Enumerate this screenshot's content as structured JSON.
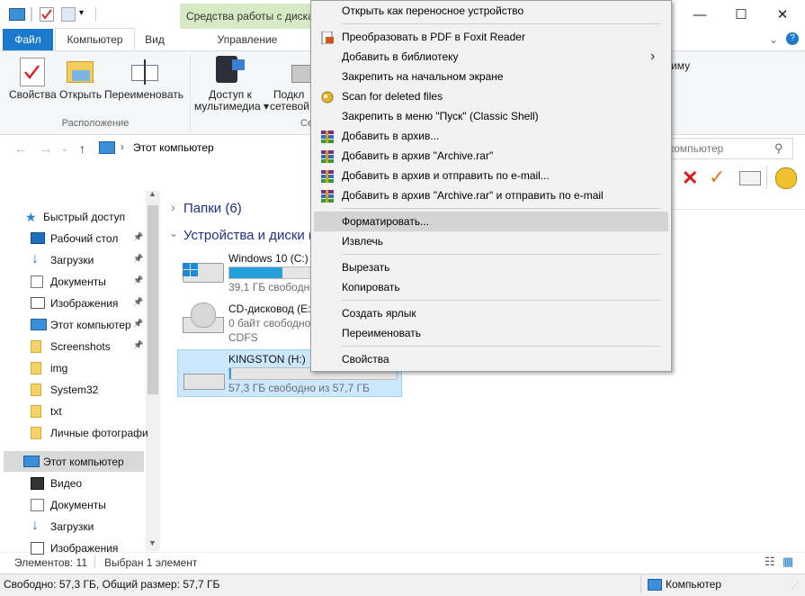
{
  "window": {
    "tools_tab": "Средства работы с дисками",
    "controls": {
      "minimize": "—",
      "maximize": "☐",
      "close": "✕"
    }
  },
  "ribbon": {
    "tabs": {
      "file": "Файл",
      "computer": "Компьютер",
      "view": "Вид",
      "manage": "Управление"
    },
    "buttons": {
      "properties": "Свойства",
      "open": "Открыть",
      "rename": "Переименовать",
      "media_access_l1": "Доступ к",
      "media_access_l2": "мультимедиа ▾",
      "network_l1": "Подкл",
      "network_l2": "сетевой",
      "right_partial": "иму"
    },
    "groups": {
      "location": "Расположение",
      "network_partial": "Се"
    }
  },
  "address": {
    "path": "Этот компьютер",
    "search_placeholder": "т компьютер"
  },
  "sidebar": {
    "quick_access": "Быстрый доступ",
    "items": [
      {
        "label": "Рабочий стол",
        "pinned": true
      },
      {
        "label": "Загрузки",
        "pinned": true
      },
      {
        "label": "Документы",
        "pinned": true
      },
      {
        "label": "Изображения",
        "pinned": true
      },
      {
        "label": "Этот компьютер",
        "pinned": true
      },
      {
        "label": "Screenshots",
        "pinned": true
      },
      {
        "label": "img",
        "pinned": false
      },
      {
        "label": "System32",
        "pinned": false
      },
      {
        "label": "txt",
        "pinned": false
      },
      {
        "label": "Личные фотографи",
        "pinned": false
      }
    ],
    "this_pc": "Этот компьютер",
    "this_pc_items": [
      "Видео",
      "Документы",
      "Загрузки",
      "Изображения"
    ]
  },
  "content": {
    "folders_head": "Папки (6)",
    "devices_head": "Устройства и диски (",
    "drives": [
      {
        "name": "Windows 10 (C:)",
        "free": "39,1 ГБ свободно",
        "fill_fraction": 0.66
      },
      {
        "name": "CD-дисковод (E:)",
        "free": "0 байт свободно",
        "fs": "CDFS"
      },
      {
        "name": "KINGSTON (H:)",
        "free": "57,3 ГБ свободно из 57,7 ГБ",
        "fill_fraction": 0.01
      }
    ]
  },
  "context_menu": {
    "items": [
      {
        "label": "Открыть как переносное устройство",
        "icon": "none"
      },
      {
        "label": "Преобразовать в PDF в Foxit Reader",
        "icon": "pdf-icon"
      },
      {
        "label": "Добавить в библиотеку",
        "icon": "none",
        "submenu": true
      },
      {
        "label": "Закрепить на начальном экране",
        "icon": "none"
      },
      {
        "label": "Scan for deleted files",
        "icon": "recovery-icon"
      },
      {
        "label": "Закрепить в меню \"Пуск\" (Classic Shell)",
        "icon": "none"
      },
      {
        "label": "Добавить в архив...",
        "icon": "winrar-icon"
      },
      {
        "label": "Добавить в архив \"Archive.rar\"",
        "icon": "winrar-icon"
      },
      {
        "label": "Добавить в архив и отправить по e-mail...",
        "icon": "winrar-icon"
      },
      {
        "label": "Добавить в архив \"Archive.rar\" и отправить по e-mail",
        "icon": "winrar-icon"
      },
      {
        "label": "Форматировать...",
        "icon": "none",
        "highlighted": true
      },
      {
        "label": "Извлечь",
        "icon": "none"
      },
      {
        "label": "Вырезать",
        "icon": "none"
      },
      {
        "label": "Копировать",
        "icon": "none"
      },
      {
        "label": "Создать ярлык",
        "icon": "none"
      },
      {
        "label": "Переименовать",
        "icon": "none"
      },
      {
        "label": "Свойства",
        "icon": "none"
      }
    ],
    "submenu_arrow": "›"
  },
  "status": {
    "items_count": "Элементов: 11",
    "selected": "Выбран 1 элемент",
    "free_info": "Свободно: 57,3 ГБ, Общий размер: 57,7 ГБ",
    "location": "Компьютер"
  },
  "colors": {
    "accent": "#1979ca",
    "tools_tab": "#d7eac6",
    "section_head": "#1e3287",
    "selection": "#cce8ff",
    "bar_fill": "#26a0da",
    "menu_bg": "#f2f2f2",
    "menu_highlight": "#d4d4d4"
  }
}
